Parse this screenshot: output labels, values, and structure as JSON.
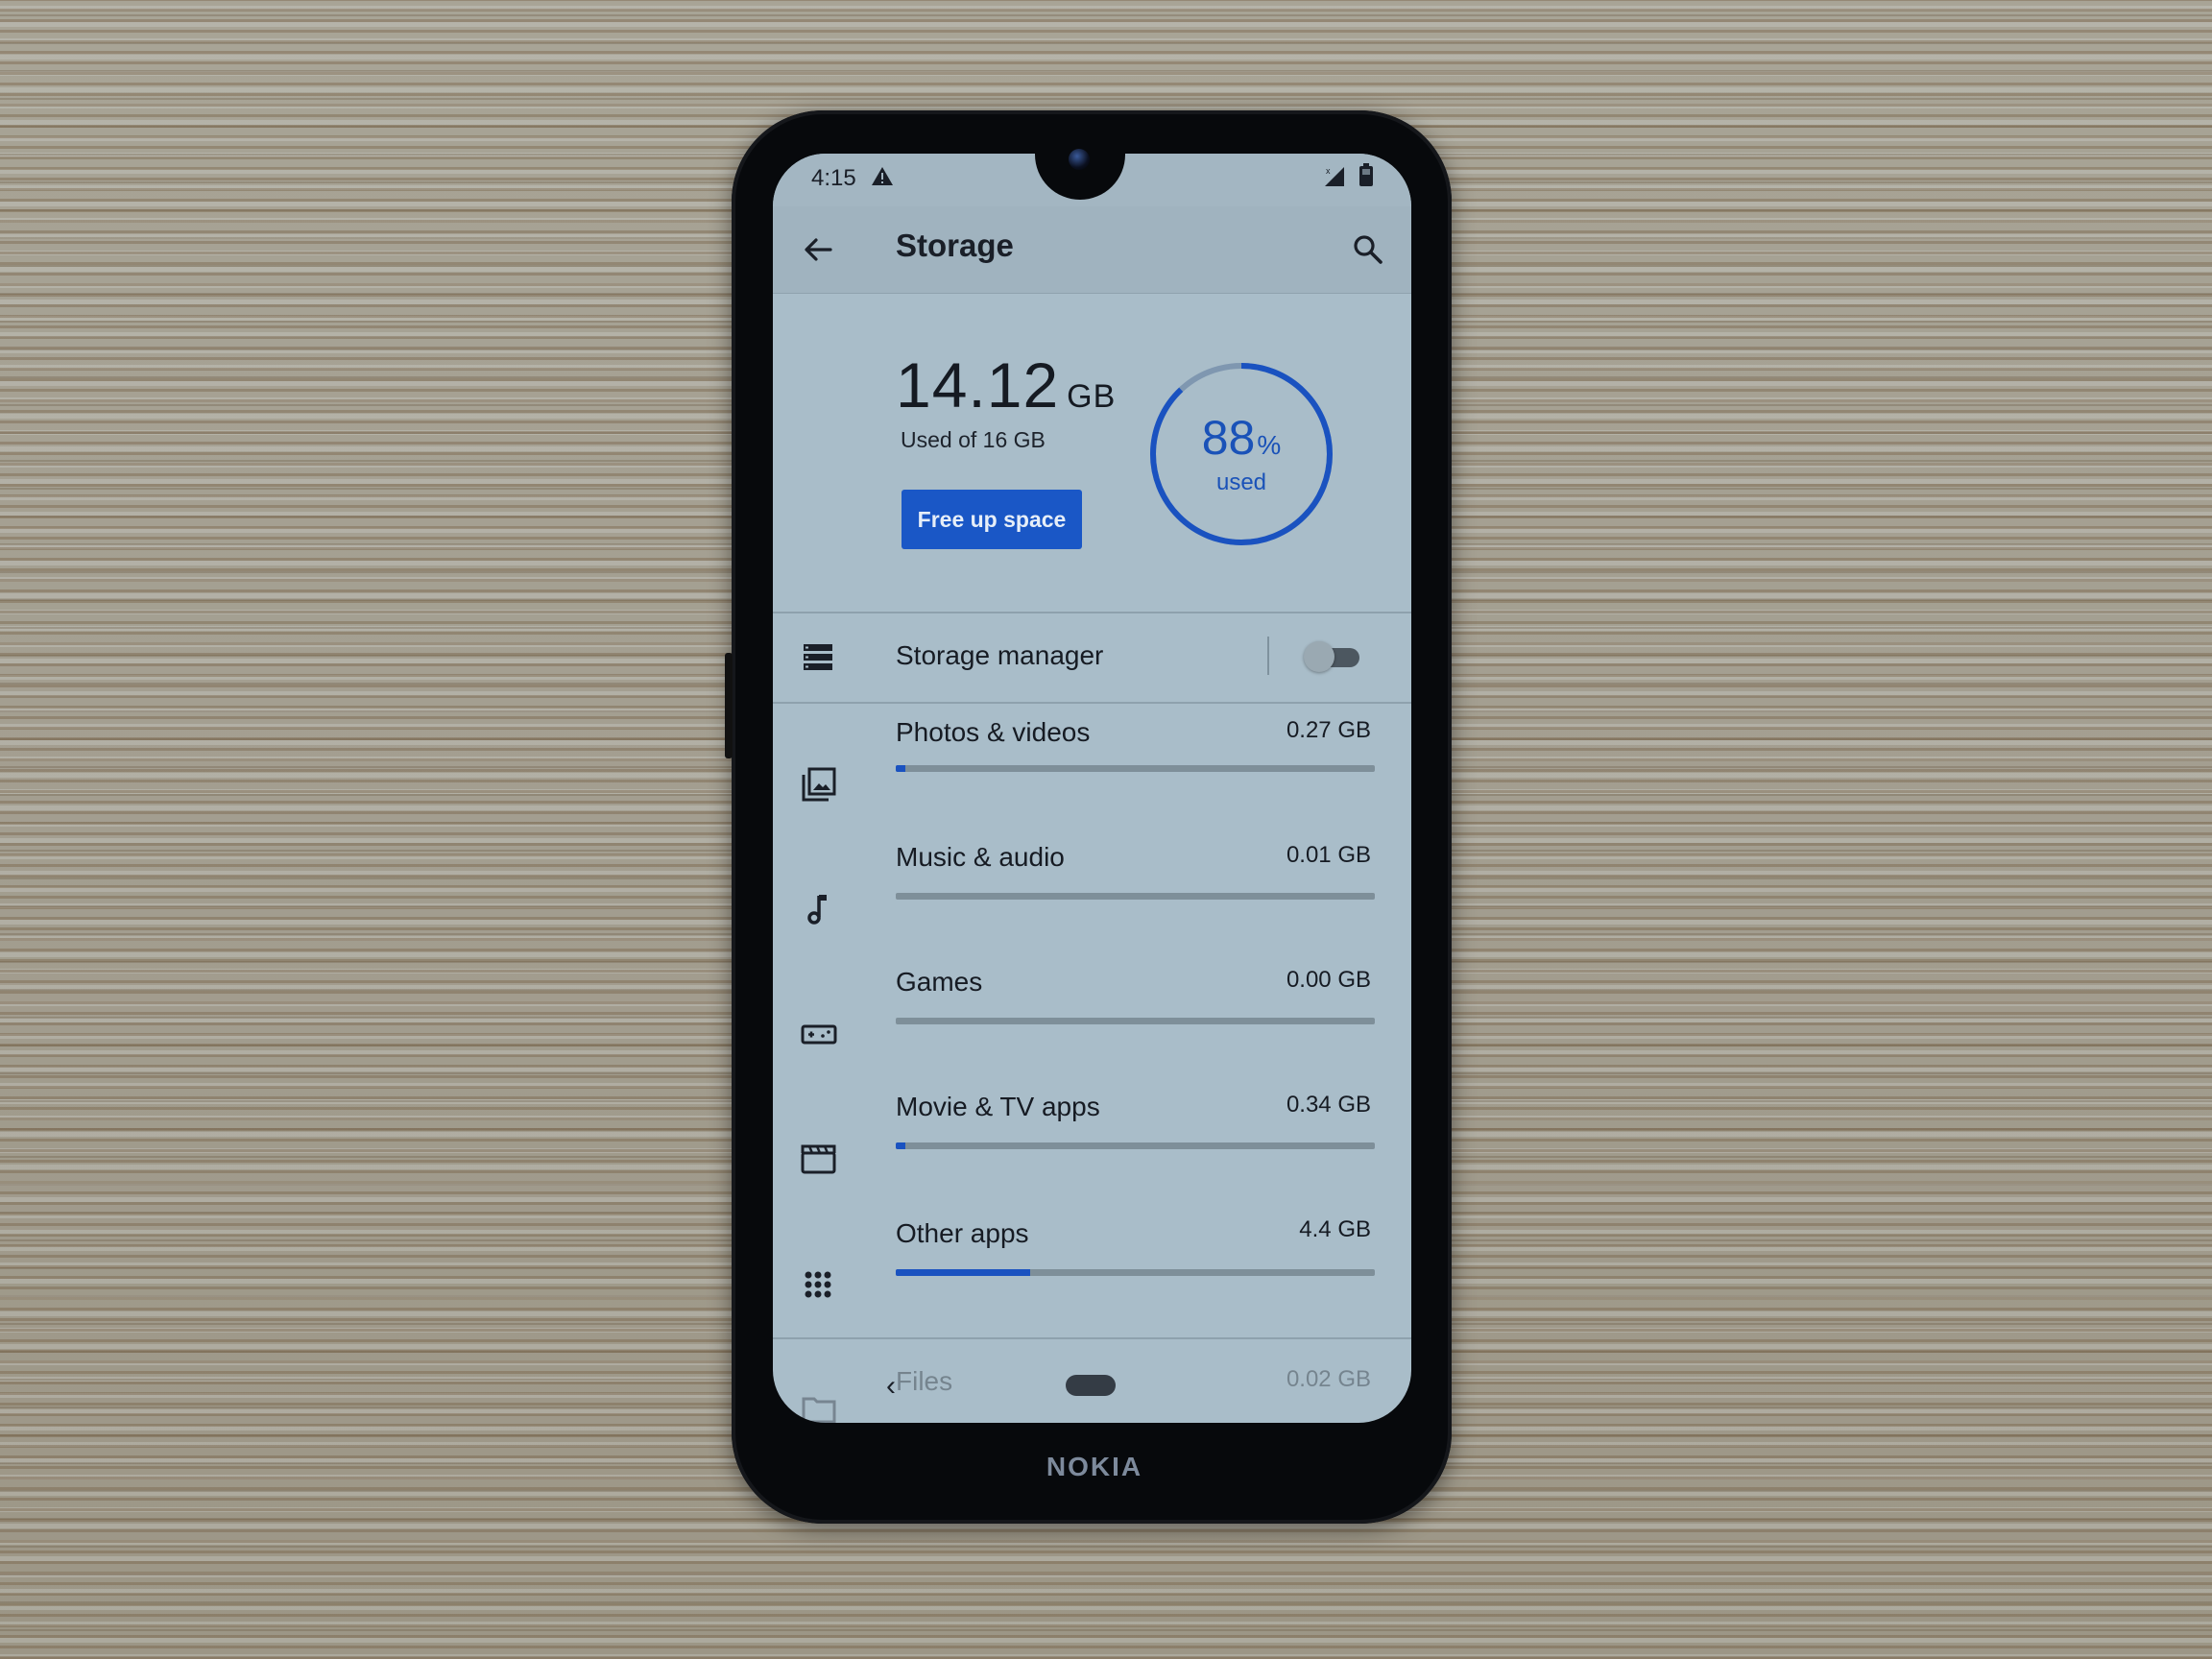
{
  "status_bar": {
    "time": "4:15",
    "icons": [
      "warning-icon",
      "signal-no-data-icon",
      "battery-icon"
    ]
  },
  "app_bar": {
    "title": "Storage",
    "back_icon": "arrow-left-icon",
    "search_icon": "search-icon"
  },
  "summary": {
    "used_value": "14.12",
    "used_unit": "GB",
    "used_of": "Used of 16 GB",
    "percent": "88",
    "percent_sign": "%",
    "percent_label": "used",
    "percent_fraction": 0.88,
    "free_up_button": "Free up space"
  },
  "storage_manager": {
    "label": "Storage manager",
    "icon": "storage-list-icon",
    "enabled": false
  },
  "categories": [
    {
      "label": "Photos & videos",
      "size": "0.27 GB",
      "icon": "photos-icon",
      "fraction": 0.02
    },
    {
      "label": "Music & audio",
      "size": "0.01 GB",
      "icon": "music-note-icon",
      "fraction": 0.0
    },
    {
      "label": "Games",
      "size": "0.00 GB",
      "icon": "gamepad-icon",
      "fraction": 0.0
    },
    {
      "label": "Movie & TV apps",
      "size": "0.34 GB",
      "icon": "clapperboard-icon",
      "fraction": 0.02
    },
    {
      "label": "Other apps",
      "size": "4.4 GB",
      "icon": "apps-grid-icon",
      "fraction": 0.28
    },
    {
      "label": "Files",
      "size": "0.02 GB",
      "icon": "folder-icon",
      "fraction": 0.0
    }
  ],
  "nav_bar": {
    "back_glyph": "‹"
  },
  "device": {
    "brand": "NOKIA"
  },
  "colors": {
    "accent": "#1a57c6",
    "screen_bg": "#a9bdc9",
    "text": "#161b23"
  }
}
